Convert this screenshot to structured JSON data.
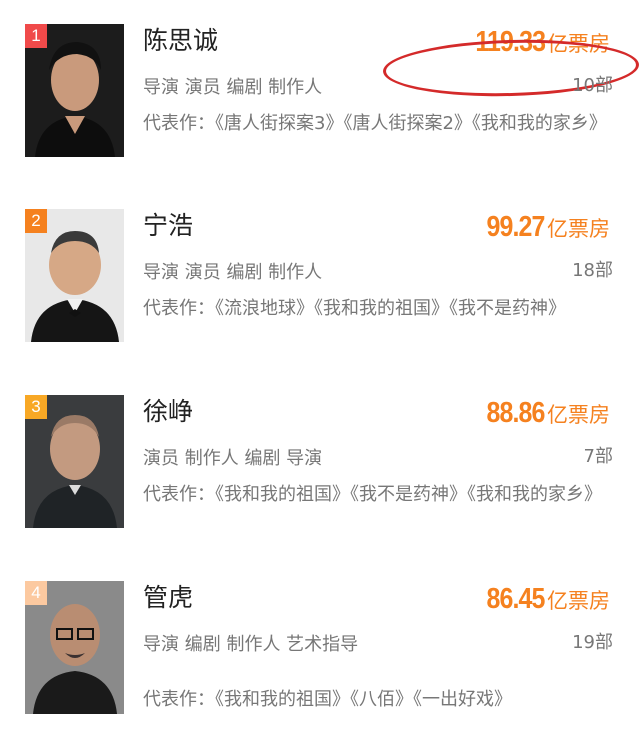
{
  "colors": {
    "accent": "#f5811f",
    "rank_1": "#f04a4a",
    "rank_2": "#f5811f",
    "rank_3": "#f8a825",
    "rank_4": "#fcc9a0",
    "highlight_circle": "#d42a2a"
  },
  "list": [
    {
      "rank": "1",
      "name": "陈思诚",
      "boxoffice_value": "119.33",
      "boxoffice_unit": "亿票房",
      "roles": "导演 演员 编剧 制作人",
      "count": "10部",
      "works": "代表作：《唐人街探案3》《唐人街探案2》《我和我的家乡》"
    },
    {
      "rank": "2",
      "name": "宁浩",
      "boxoffice_value": "99.27",
      "boxoffice_unit": "亿票房",
      "roles": "导演 演员 编剧 制作人",
      "count": "18部",
      "works": "代表作：《流浪地球》《我和我的祖国》《我不是药神》"
    },
    {
      "rank": "3",
      "name": "徐峥",
      "boxoffice_value": "88.86",
      "boxoffice_unit": "亿票房",
      "roles": "演员 制作人 编剧 导演",
      "count": "7部",
      "works": "代表作：《我和我的祖国》《我不是药神》《我和我的家乡》"
    },
    {
      "rank": "4",
      "name": "管虎",
      "boxoffice_value": "86.45",
      "boxoffice_unit": "亿票房",
      "roles": "导演 编剧 制作人 艺术指导",
      "count": "19部",
      "works": "代表作：《我和我的祖国》《八佰》《一出好戏》"
    }
  ]
}
